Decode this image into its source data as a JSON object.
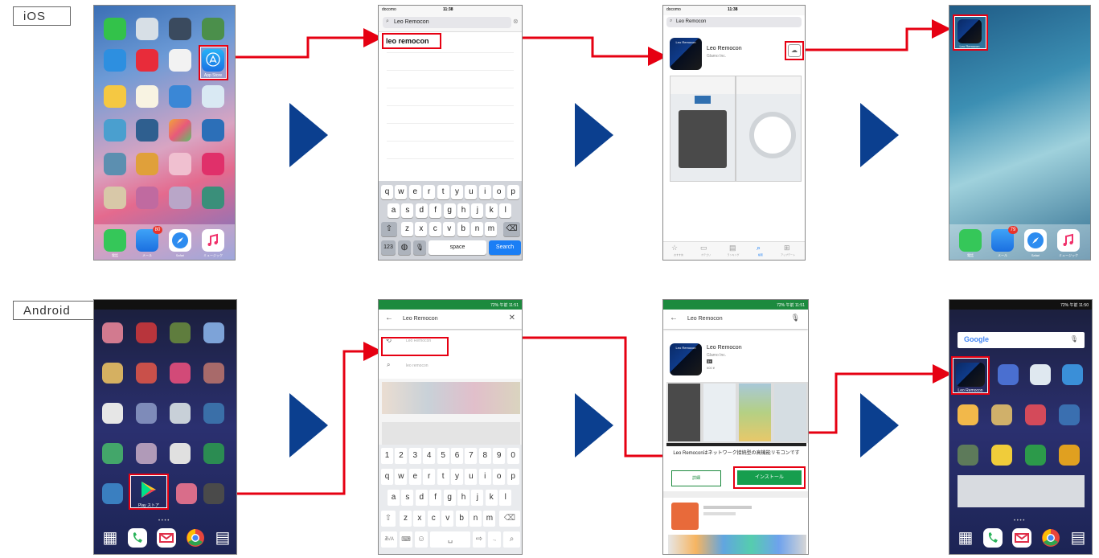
{
  "labels": {
    "ios": "iOS",
    "android": "Android"
  },
  "ios_home": {
    "app_store_label": "App Store",
    "dock": [
      "電話",
      "メール",
      "Safari",
      "ミュージック"
    ],
    "mail_badge": "80"
  },
  "ios_search": {
    "carrier": "docomo",
    "time": "11:38",
    "query": "Leo Remocon",
    "suggestion": "leo remocon",
    "keys_row1": [
      "q",
      "w",
      "e",
      "r",
      "t",
      "y",
      "u",
      "i",
      "o",
      "p"
    ],
    "keys_row2": [
      "a",
      "s",
      "d",
      "f",
      "g",
      "h",
      "j",
      "k",
      "l"
    ],
    "keys_row3": [
      "z",
      "x",
      "c",
      "v",
      "b",
      "n",
      "m"
    ],
    "key_123": "123",
    "key_space": "space",
    "key_search": "Search"
  },
  "ios_store": {
    "carrier": "docomo",
    "time": "11:38",
    "query": "Leo Remocon",
    "app_name": "Leo Remocon",
    "developer": "Glamo Inc.",
    "tabs": [
      "おすすめ",
      "カテゴリ",
      "ランキング",
      "検索",
      "アップデート"
    ]
  },
  "ios_done": {
    "app_label": "Leo Remocon",
    "dock": [
      "電話",
      "メール",
      "Safari",
      "ミュージック"
    ],
    "mail_badge": "79"
  },
  "and_home": {
    "play_label": "Play ストア"
  },
  "and_search": {
    "status": "72% 午前 11:51",
    "query": "Leo Remocon",
    "history_item": "Leo Remocon",
    "suggest_item": "leo remocon",
    "num_row": [
      "1",
      "2",
      "3",
      "4",
      "5",
      "6",
      "7",
      "8",
      "9",
      "0"
    ],
    "keys_row1": [
      "q",
      "w",
      "e",
      "r",
      "t",
      "y",
      "u",
      "i",
      "o",
      "p"
    ],
    "keys_row2": [
      "a",
      "s",
      "d",
      "f",
      "g",
      "h",
      "j",
      "k",
      "l"
    ],
    "keys_row3": [
      "z",
      "x",
      "c",
      "v",
      "b",
      "n",
      "m"
    ],
    "key_lang": "あ/A"
  },
  "and_store": {
    "status": "72% 午前 11:51",
    "query": "Leo Remocon",
    "app_name": "Leo Remocon",
    "developer": "Glamo Inc.",
    "rating_tag": "3+",
    "price": "500 ¥",
    "desc": "Leo Remoconはネットワーク接続型の高機能リモコンです",
    "install_button": "インストール",
    "details_button": "詳細"
  },
  "and_done": {
    "status": "72% 午前 11:50",
    "google": "Google",
    "app_label": "Leo Remocon"
  },
  "colors": {
    "arrow": "#e60012",
    "chevron": "#0b3f8f",
    "play_green": "#169e4e"
  }
}
